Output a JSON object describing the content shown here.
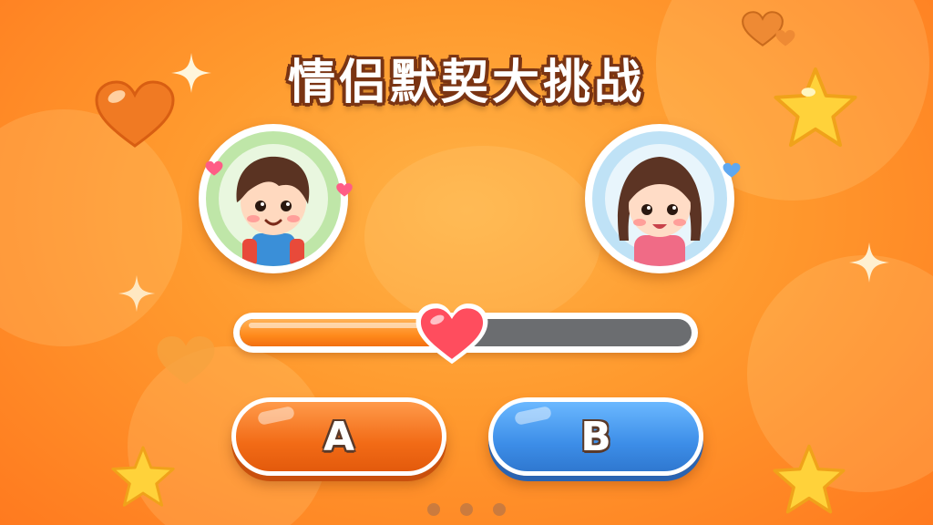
{
  "game": {
    "title": "情侣默契大挑战",
    "accent_color": "#ff8a1c",
    "background_color": "#ff9a2e"
  },
  "players": {
    "left": {
      "icon": "boy-avatar-icon"
    },
    "right": {
      "icon": "girl-avatar-icon"
    }
  },
  "progress": {
    "fraction": 0.47,
    "knob_icon": "heart-icon",
    "fill_color": "#ff8a1c",
    "track_color": "#6b6d70"
  },
  "answers": {
    "a_label": "A",
    "b_label": "B",
    "a_color": "#f26b16",
    "b_color": "#3d8ee8"
  },
  "pagination": {
    "count": 3
  },
  "decorations": [
    "heart-icon",
    "star-icon",
    "sparkle-icon"
  ]
}
